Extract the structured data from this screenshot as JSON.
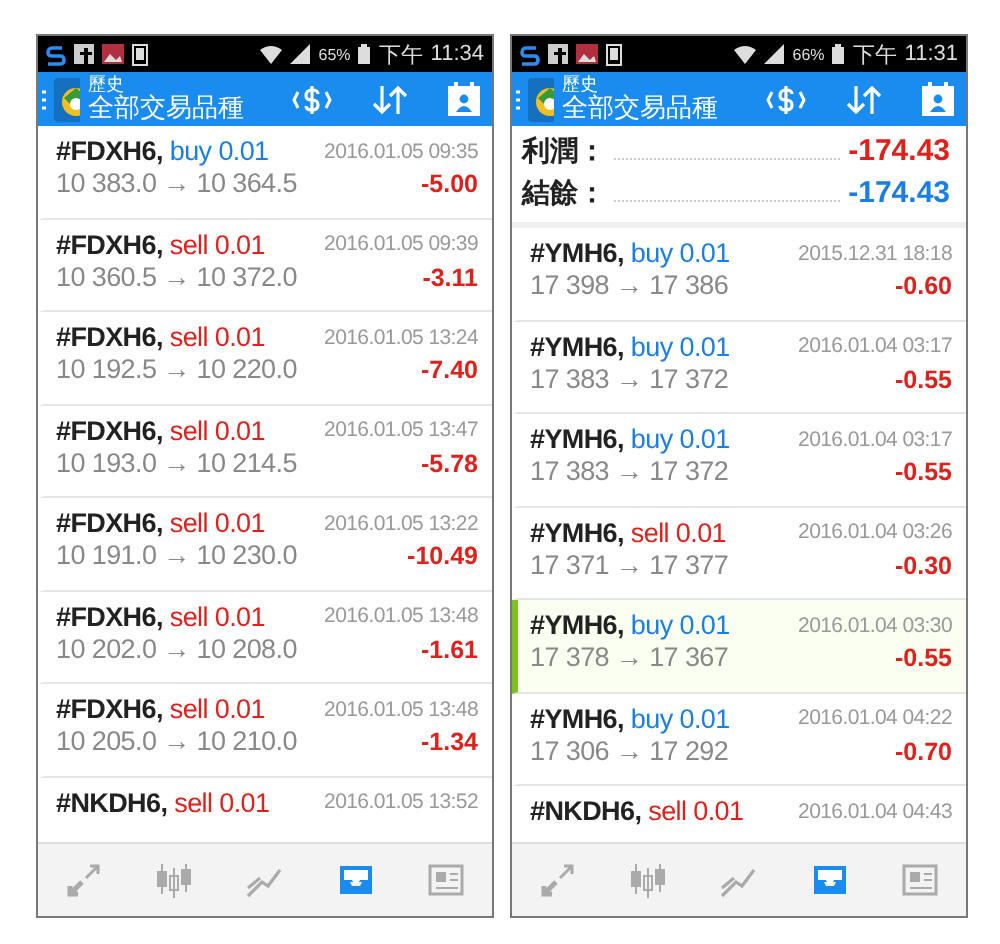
{
  "phones": [
    {
      "status_bar": {
        "battery": "65%",
        "ampm": "下午",
        "time": "11:34"
      },
      "header": {
        "title": "歷史",
        "subtitle": "全部交易品種"
      },
      "trades": [
        {
          "symbol": "#FDXH6,",
          "kind": "buy",
          "order": "buy 0.01",
          "date": "2016.01.05 09:35",
          "prices": "10 383.0 → 10 364.5",
          "profit": "-5.00",
          "selected": false
        },
        {
          "symbol": "#FDXH6,",
          "kind": "sell",
          "order": "sell 0.01",
          "date": "2016.01.05 09:39",
          "prices": "10 360.5 → 10 372.0",
          "profit": "-3.11",
          "selected": false
        },
        {
          "symbol": "#FDXH6,",
          "kind": "sell",
          "order": "sell 0.01",
          "date": "2016.01.05 13:24",
          "prices": "10 192.5 → 10 220.0",
          "profit": "-7.40",
          "selected": false
        },
        {
          "symbol": "#FDXH6,",
          "kind": "sell",
          "order": "sell 0.01",
          "date": "2016.01.05 13:47",
          "prices": "10 193.0 → 10 214.5",
          "profit": "-5.78",
          "selected": false
        },
        {
          "symbol": "#FDXH6,",
          "kind": "sell",
          "order": "sell 0.01",
          "date": "2016.01.05 13:22",
          "prices": "10 191.0 → 10 230.0",
          "profit": "-10.49",
          "selected": false
        },
        {
          "symbol": "#FDXH6,",
          "kind": "sell",
          "order": "sell 0.01",
          "date": "2016.01.05 13:48",
          "prices": "10 202.0 → 10 208.0",
          "profit": "-1.61",
          "selected": false
        },
        {
          "symbol": "#FDXH6,",
          "kind": "sell",
          "order": "sell 0.01",
          "date": "2016.01.05 13:48",
          "prices": "10 205.0 → 10 210.0",
          "profit": "-1.34",
          "selected": false
        },
        {
          "symbol": "#NKDH6,",
          "kind": "sell",
          "order": "sell 0.01",
          "date": "2016.01.05 13:52",
          "selected": false
        }
      ],
      "nav": [
        {
          "kind": "trade",
          "selected": false
        },
        {
          "kind": "quotes",
          "selected": false
        },
        {
          "kind": "chart",
          "selected": false
        },
        {
          "kind": "history",
          "selected": true
        },
        {
          "kind": "news",
          "selected": false
        }
      ]
    },
    {
      "status_bar": {
        "battery": "66%",
        "ampm": "下午",
        "time": "11:31"
      },
      "header": {
        "title": "歷史",
        "subtitle": "全部交易品種"
      },
      "summary": [
        {
          "label": "利潤：",
          "value": "-174.43",
          "kind": "profit"
        },
        {
          "label": "結餘：",
          "value": "-174.43",
          "kind": "balance"
        }
      ],
      "trades": [
        {
          "symbol": "#YMH6,",
          "kind": "buy",
          "order": "buy 0.01",
          "date": "2015.12.31 18:18",
          "prices": "17 398 → 17 386",
          "profit": "-0.60",
          "selected": false
        },
        {
          "symbol": "#YMH6,",
          "kind": "buy",
          "order": "buy 0.01",
          "date": "2016.01.04 03:17",
          "prices": "17 383 → 17 372",
          "profit": "-0.55",
          "selected": false
        },
        {
          "symbol": "#YMH6,",
          "kind": "buy",
          "order": "buy 0.01",
          "date": "2016.01.04 03:17",
          "prices": "17 383 → 17 372",
          "profit": "-0.55",
          "selected": false
        },
        {
          "symbol": "#YMH6,",
          "kind": "sell",
          "order": "sell 0.01",
          "date": "2016.01.04 03:26",
          "prices": "17 371 → 17 377",
          "profit": "-0.30",
          "selected": false
        },
        {
          "symbol": "#YMH6,",
          "kind": "buy",
          "order": "buy 0.01",
          "date": "2016.01.04 03:30",
          "prices": "17 378 → 17 367",
          "profit": "-0.55",
          "selected": true
        },
        {
          "symbol": "#YMH6,",
          "kind": "buy",
          "order": "buy 0.01",
          "date": "2016.01.04 04:22",
          "prices": "17 306 → 17 292",
          "profit": "-0.70",
          "selected": false
        },
        {
          "symbol": "#NKDH6,",
          "kind": "sell",
          "order": "sell 0.01",
          "date": "2016.01.04 04:43",
          "selected": false
        }
      ],
      "nav": [
        {
          "kind": "trade",
          "selected": false
        },
        {
          "kind": "quotes",
          "selected": false
        },
        {
          "kind": "chart",
          "selected": false
        },
        {
          "kind": "history",
          "selected": true
        },
        {
          "kind": "news",
          "selected": false
        }
      ]
    }
  ]
}
